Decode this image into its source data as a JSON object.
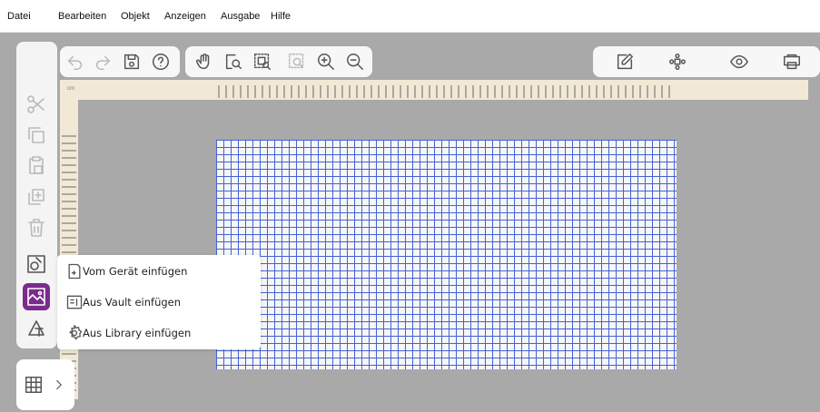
{
  "menubar": {
    "items": [
      "Datei",
      "Bearbeiten",
      "Objekt",
      "Anzeigen",
      "Ausgabe",
      "Hilfe"
    ]
  },
  "toolbar": {
    "left_icons": [
      "page-setup-icon",
      "undo-icon",
      "redo-icon",
      "save-icon",
      "help-icon"
    ],
    "view_icons": [
      "hand-pan-icon",
      "zoom-page-icon",
      "zoom-selection-icon",
      "zoom-object-icon",
      "zoom-in-icon",
      "zoom-out-icon"
    ],
    "right_icons": [
      "edit-icon",
      "arrange-icon",
      "preview-icon",
      "output-icon"
    ]
  },
  "sidebar": {
    "icons": [
      "cut-icon",
      "copy-icon",
      "paste-icon",
      "duplicate-icon",
      "delete-icon",
      "insert-shape-icon",
      "insert-image-icon",
      "insert-text-shape-icon"
    ]
  },
  "ruler": {
    "unit": "cm"
  },
  "popup_menu": {
    "items": [
      {
        "label": "Vom Gerät einfügen",
        "icon": "device-import-icon"
      },
      {
        "label": "Aus Vault einfügen",
        "icon": "vault-import-icon"
      },
      {
        "label": "Aus Library einfügen",
        "icon": "library-import-icon"
      }
    ]
  },
  "bottom_panel": {
    "icons": [
      "grid-table-icon",
      "chevron-right-icon"
    ]
  },
  "colors": {
    "accent": "#7b2a8e",
    "grid_line": "#3b5bd8",
    "ruler": "#f1e9d6",
    "workspace": "#a9a9a9"
  }
}
